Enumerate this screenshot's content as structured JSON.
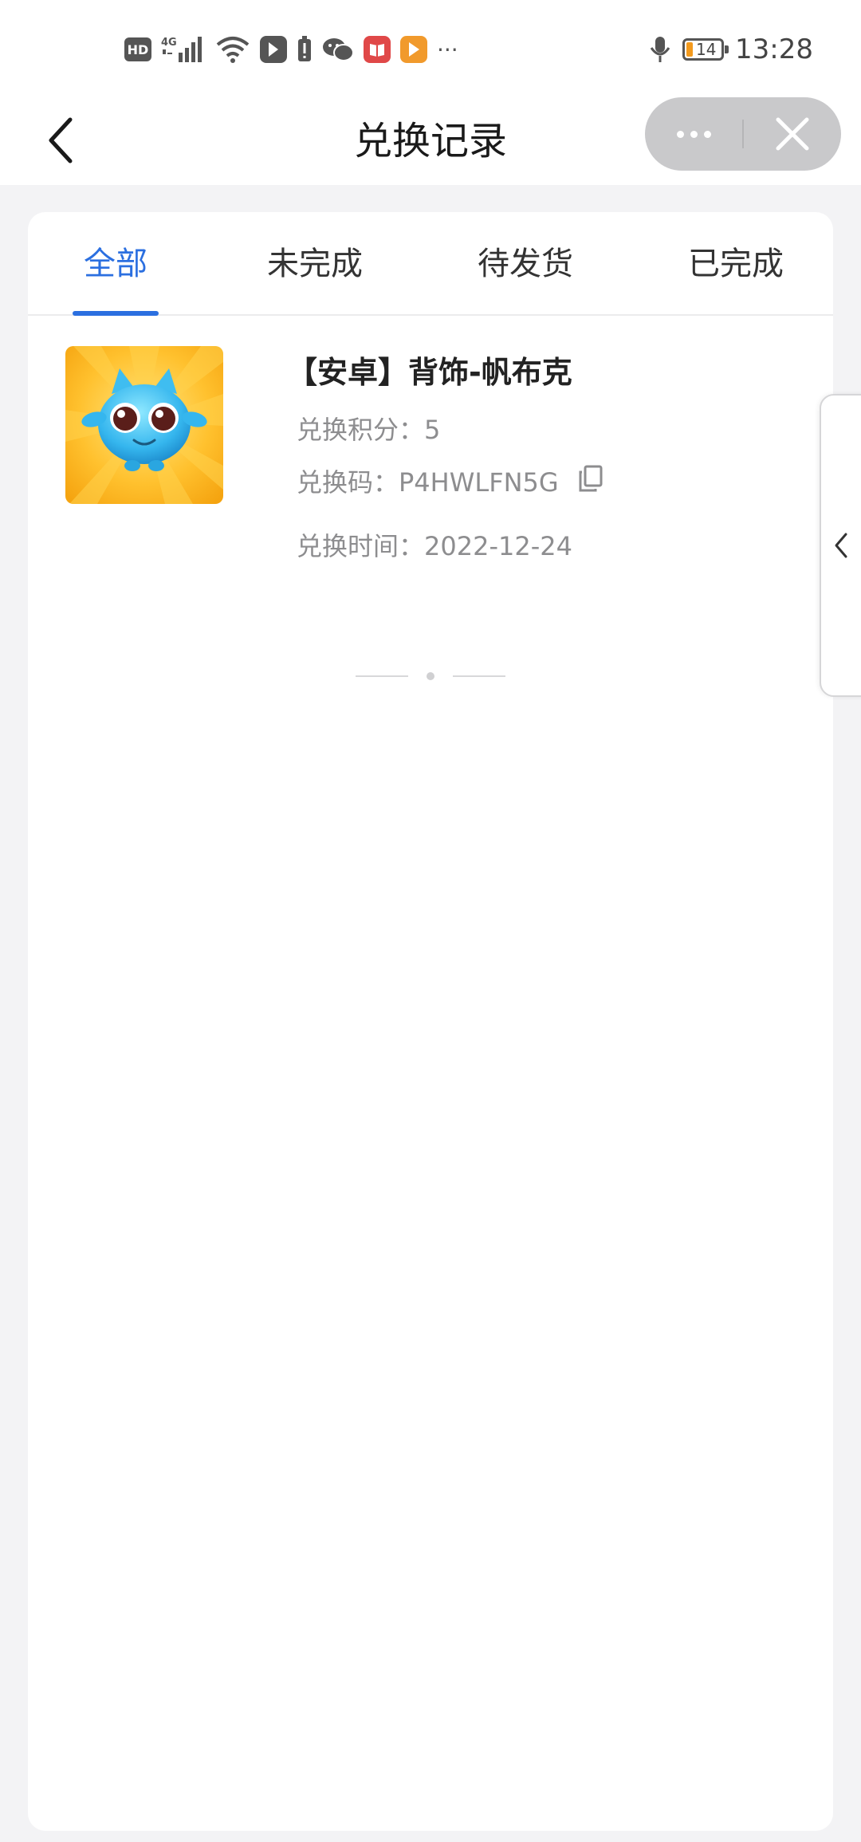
{
  "status_bar": {
    "hd_label": "HD",
    "network_label": "4G",
    "battery_level": "14",
    "time": "13:28",
    "more_label": "···",
    "icons": [
      "hd-icon",
      "signal-icon",
      "wifi-icon",
      "app-icon",
      "alert-icon",
      "wechat-icon",
      "book-icon",
      "video-icon",
      "mic-icon",
      "battery-icon"
    ]
  },
  "nav": {
    "title": "兑换记录"
  },
  "tabs": [
    {
      "label": "全部",
      "active": true
    },
    {
      "label": "未完成",
      "active": false
    },
    {
      "label": "待发货",
      "active": false
    },
    {
      "label": "已完成",
      "active": false
    }
  ],
  "records": [
    {
      "title": "【安卓】背饰-帆布克",
      "points": "兑换积分：5",
      "code": "兑换码：P4HWLFN5G",
      "time": "兑换时间：2022-12-24"
    }
  ],
  "colors": {
    "accent": "#2b6fe0",
    "page_background": "#f3f3f5",
    "secondary_text": "#8d8d8f",
    "capsule": "#c9c9cb"
  }
}
